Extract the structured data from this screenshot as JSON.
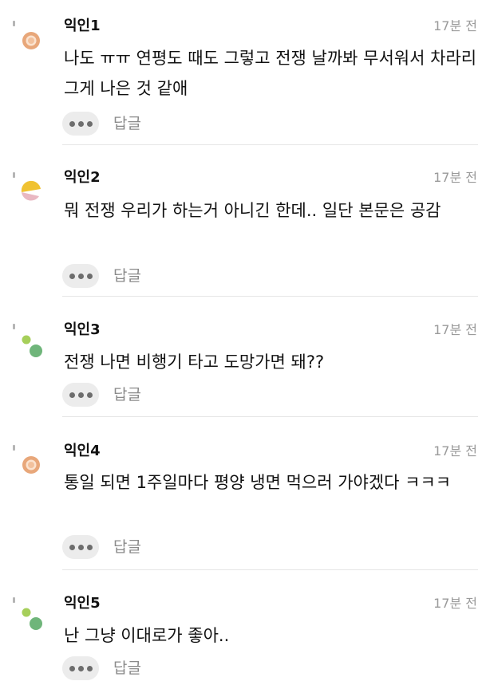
{
  "comments": [
    {
      "author": "익인1",
      "time": "17분 전",
      "text": "나도 ㅠㅠ 연평도 때도 그렇고 전쟁 날까봐 무서워서 차라리 그게 나은 것 같애",
      "reply_label": "답글",
      "avatar_icon": "orange-ring-avatar-icon"
    },
    {
      "author": "익인2",
      "time": "17분 전",
      "text": "뭐 전쟁 우리가 하는거 아니긴 한데.. 일단 본문은 공감",
      "reply_label": "답글",
      "avatar_icon": "yellow-pink-semicircle-avatar-icon"
    },
    {
      "author": "익인3",
      "time": "17분 전",
      "text": "전쟁 나면 비행기 타고 도망가면 돼??",
      "reply_label": "답글",
      "avatar_icon": "green-dots-avatar-icon"
    },
    {
      "author": "익인4",
      "time": "17분 전",
      "text": "통일 되면 1주일마다 평양 냉면 먹으러 가야겠다 ㅋㅋㅋ",
      "reply_label": "답글",
      "avatar_icon": "orange-ring-avatar-icon"
    },
    {
      "author": "익인5",
      "time": "17분 전",
      "text": "난 그냥 이대로가 좋아..",
      "reply_label": "답글",
      "avatar_icon": "green-dots-avatar-icon"
    }
  ],
  "colors": {
    "avatar_orange": "#e8a77a",
    "avatar_yellow": "#f0c232",
    "avatar_pink": "#e9b8c2",
    "avatar_green_light": "#a6cf5a",
    "avatar_green": "#6fb57a",
    "meta_gray": "#9a9a9a",
    "button_bg": "#ececec"
  }
}
